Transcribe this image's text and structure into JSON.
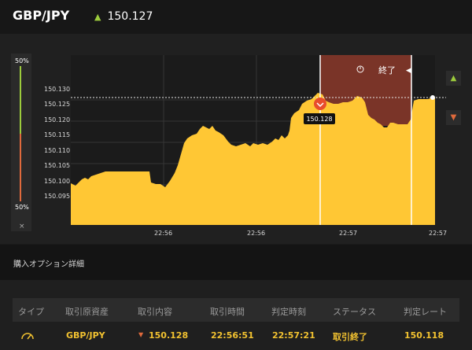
{
  "header": {
    "pair": "GBP/JPY",
    "price": "150.127"
  },
  "meter": {
    "top": "50%",
    "bottom": "50%",
    "close": "×"
  },
  "chart": {
    "y_ticks": [
      "150.130",
      "150.125",
      "150.120",
      "150.115",
      "150.110",
      "150.105",
      "150.100",
      "150.095"
    ],
    "x_ticks": [
      "22:56",
      "22:56",
      "22:57",
      "22:57"
    ],
    "marker": "150.128",
    "end_label": "終了"
  },
  "section": {
    "title": "購入オプション詳細"
  },
  "table": {
    "headers": [
      "タイプ",
      "取引原資産",
      "取引内容",
      "取引時間",
      "判定時刻",
      "ステータス",
      "判定レート"
    ],
    "row": {
      "asset": "GBP/JPY",
      "content": "150.128",
      "time": "22:56:51",
      "judge_time": "22:57:21",
      "status": "取引終了",
      "rate": "150.118"
    }
  },
  "colors": {
    "accent": "#f2c230",
    "up": "#9ccc3c",
    "down": "#e06a3c",
    "area": "#ffcc33",
    "danger": "#8b3a2e"
  }
}
